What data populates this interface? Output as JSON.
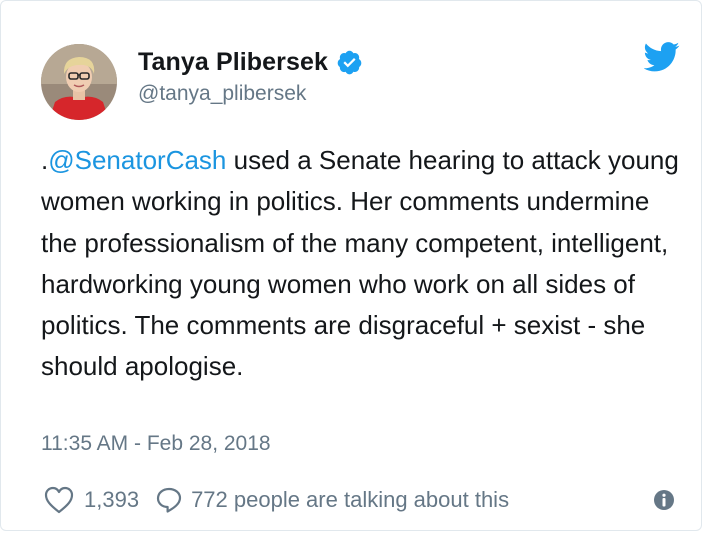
{
  "author": {
    "name": "Tanya Plibersek",
    "handle": "@tanya_plibersek",
    "verified": true
  },
  "tweet": {
    "prefix": ".",
    "mention": "@SenatorCash",
    "text_rest": " used a Senate hearing to attack young women working in politics. Her comments undermine the professionalism of the many competent, intelligent, hardworking young women who work on all sides of politics. The comments are disgraceful + sexist - she should apologise.",
    "timestamp": "11:35 AM - Feb 28, 2018"
  },
  "actions": {
    "like_count": "1,393",
    "conversation_text": "772 people are talking about this"
  },
  "icons": {
    "brand": "twitter-bird-icon",
    "verified": "verified-badge-icon",
    "like": "heart-icon",
    "reply": "speech-bubble-icon",
    "info": "info-icon"
  },
  "colors": {
    "brand_blue": "#1da1f2",
    "link_blue": "#1b95e0",
    "text": "#14171a",
    "muted": "#657786"
  }
}
